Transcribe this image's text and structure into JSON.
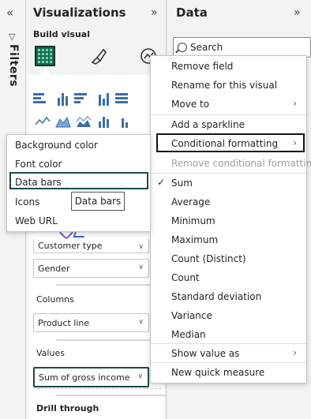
{
  "filters": {
    "label": "Filters",
    "expand_icon": "chevron-double-left"
  },
  "visualizations": {
    "title": "Visualizations",
    "collapse_icon": "chevron-double-right",
    "build_visual_label": "Build visual",
    "wells": {
      "customer_type": "Customer type",
      "gender": "Gender",
      "columns_label": "Columns",
      "product_line": "Product line",
      "values_label": "Values",
      "sum_gross_income": "Sum of gross income",
      "drill_through_label": "Drill through"
    }
  },
  "data_pane": {
    "title": "Data",
    "collapse_icon": "chevron-double-right",
    "search_placeholder": "Search"
  },
  "context_menu": {
    "items": [
      "Remove field",
      "Rename for this visual",
      "Move to",
      "Add a sparkline",
      "Conditional formatting",
      "Remove conditional formatting",
      "Sum",
      "Average",
      "Minimum",
      "Maximum",
      "Count (Distinct)",
      "Count",
      "Standard deviation",
      "Variance",
      "Median",
      "Show value as",
      "New quick measure"
    ],
    "checked_item": "Sum"
  },
  "submenu": {
    "items": [
      "Background color",
      "Font color",
      "Data bars",
      "Icons",
      "Web URL"
    ],
    "highlighted": "Data bars"
  },
  "tooltip": {
    "text": "Data bars"
  },
  "colors": {
    "accent_dark_teal": "#1b4a4a",
    "table_icon_green": "#1a6a52"
  }
}
